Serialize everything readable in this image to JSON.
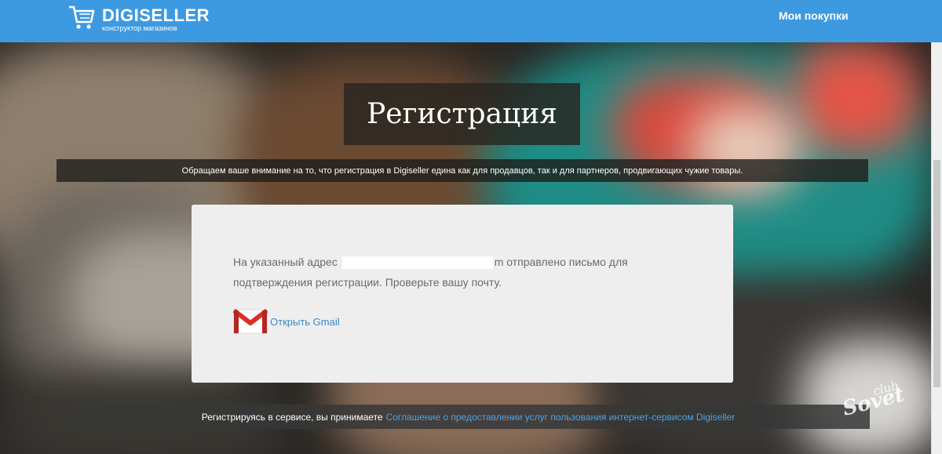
{
  "header": {
    "logo_title": "DIGISELLER",
    "logo_subtitle": "конструктор магазинов",
    "nav_my_purchases": "Мои покупки",
    "color": "#3d9ae0"
  },
  "main": {
    "title": "Регистрация",
    "notice": "Обращаем ваше внимание на то, что регистрация в Digiseller едина как для продавцов, так и для партнеров, продвигающих чужие товары.",
    "card": {
      "message_before": "На указанный адрес",
      "message_after": "m отправлено письмо для подтверждения регистрации. Проверьте вашу почту.",
      "gmail_link": "Открыть Gmail",
      "gmail_icon": "gmail-icon"
    }
  },
  "footer": {
    "text": "Регистрируясь в сервисе, вы принимаете",
    "agreement_link": "Соглашение о предоставлении услуг пользования интернет-сервисом Digiseller"
  },
  "watermark": {
    "text_top": "club",
    "text_bottom": "Sovet"
  }
}
